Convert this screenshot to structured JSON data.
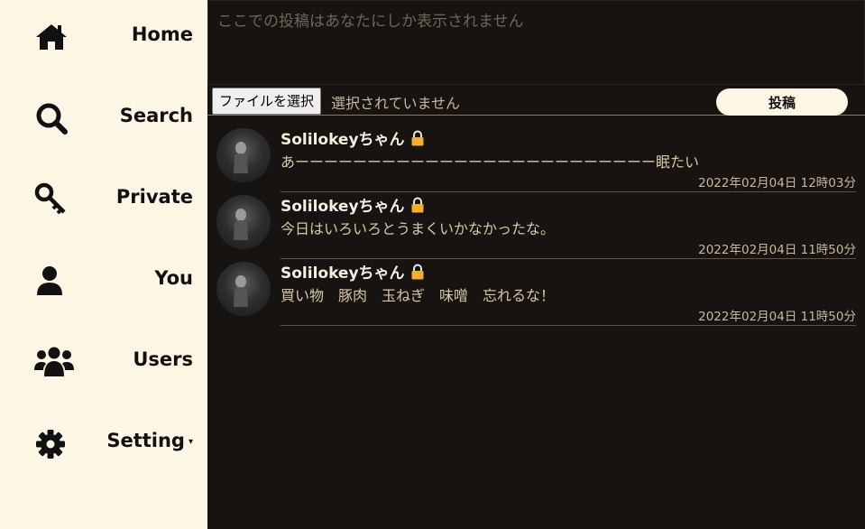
{
  "nav": {
    "items": [
      {
        "label": "Home",
        "icon": "home-icon"
      },
      {
        "label": "Search",
        "icon": "search-icon"
      },
      {
        "label": "Private",
        "icon": "key-icon"
      },
      {
        "label": "You",
        "icon": "user-icon"
      },
      {
        "label": "Users",
        "icon": "users-icon"
      },
      {
        "label": "Setting",
        "icon": "gear-icon",
        "caret": "▾"
      }
    ]
  },
  "compose": {
    "placeholder": "ここでの投稿はあなたにしか表示されません",
    "file_button": "ファイルを選択",
    "file_status": "選択されていません",
    "post_button": "投稿"
  },
  "posts": [
    {
      "author": "Solilokeyちゃん",
      "body": "あーーーーーーーーーーーーーーーーーーーーーーーーー眠たい",
      "time": "2022年02月04日 12時03分"
    },
    {
      "author": "Solilokeyちゃん",
      "body": "今日はいろいろとうまくいかなかったな。",
      "time": "2022年02月04日 11時50分"
    },
    {
      "author": "Solilokeyちゃん",
      "body": "買い物　豚肉　玉ねぎ　味噌　忘れるな！",
      "time": "2022年02月04日 11時50分"
    }
  ],
  "colors": {
    "sidebar_bg": "#fdf6e4",
    "main_bg": "#171311",
    "lock": "#f1b02a",
    "accent_text": "#c9b89a"
  }
}
